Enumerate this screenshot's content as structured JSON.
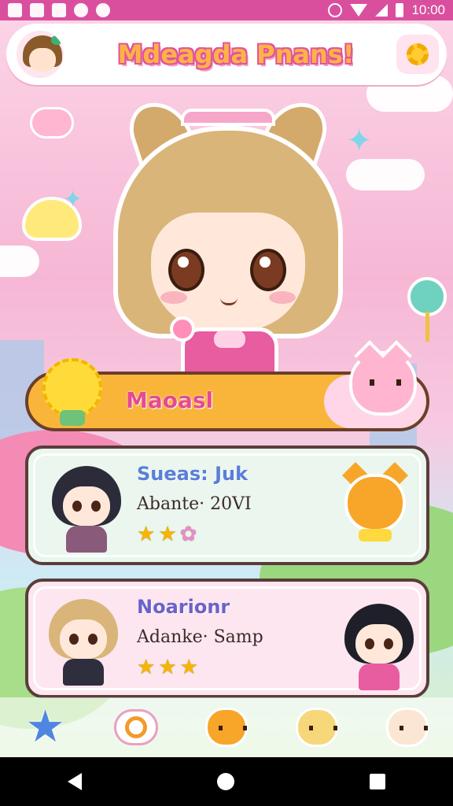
{
  "status_bar": {
    "time": "10:00",
    "icons": [
      "notification-icon",
      "gallery-icon",
      "photo-icon",
      "panda-icon",
      "play-icon",
      "alarm-icon",
      "wifi-icon",
      "signal-icon",
      "battery-icon"
    ]
  },
  "header": {
    "title": "Mdeagda Pnans!",
    "avatar_icon": "avatar",
    "settings_icon": "gear-icon"
  },
  "selected_banner": {
    "label": "Maoasl"
  },
  "cards": [
    {
      "name": "Sueas: Juk",
      "subtitle": "Abante· 20VI",
      "stars_filled": 2,
      "stars_total": 3
    },
    {
      "name": "Noarionr",
      "subtitle": "Adanke· Samp",
      "stars_filled": 3,
      "stars_total": 3
    }
  ],
  "bottom_nav": [
    {
      "icon": "star-icon"
    },
    {
      "icon": "chat-bubble-icon"
    },
    {
      "icon": "orange-cat-icon"
    },
    {
      "icon": "yellow-cat-icon"
    },
    {
      "icon": "cream-cat-icon"
    }
  ],
  "system_nav": [
    "back-icon",
    "home-icon",
    "recents-icon"
  ],
  "colors": {
    "status_bar": "#d94f9e",
    "banner": "#f9b53a",
    "card_one": "#eaf6ee",
    "card_two": "#fde6ef",
    "title_fill": "#ffb347",
    "title_outline": "#e0559d"
  }
}
